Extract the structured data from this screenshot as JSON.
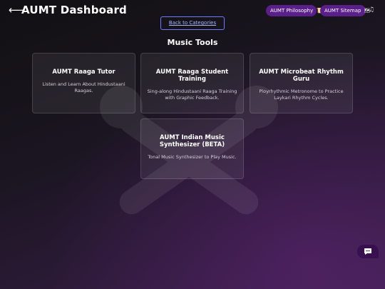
{
  "header": {
    "title": "AUMT Dashboard",
    "back_arrow": "⟵",
    "links": [
      {
        "label": "AUMT Philosophy",
        "icon": "📜"
      },
      {
        "label": "AUMT Sitemap",
        "icon": "🗺"
      }
    ],
    "music_icon": "♫"
  },
  "back_button": {
    "label": "Back to Categories"
  },
  "section": {
    "title": "Music Tools"
  },
  "cards": [
    {
      "title": "AUMT Raaga Tutor",
      "description": "Listen and Learn About Hindustaani Raagas."
    },
    {
      "title": "AUMT Raaga Student Training",
      "description": "Sing-along Hindustaani Raaga Training with Graphic Feedback."
    },
    {
      "title": "AUMT Microbeat Rhythm Guru",
      "description": "Ployrhythmic Metronome to Practice Laykari Rhythm Cycles."
    },
    {
      "title": "AUMT Indian Music Synthesizer (BETA)",
      "description": "Tonal Music Synthesizer to Play Music."
    }
  ],
  "colors": {
    "pill_bg": "#5b1f8a",
    "accent_border": "#6b7cff",
    "background_tint": "#3b1f4a"
  }
}
